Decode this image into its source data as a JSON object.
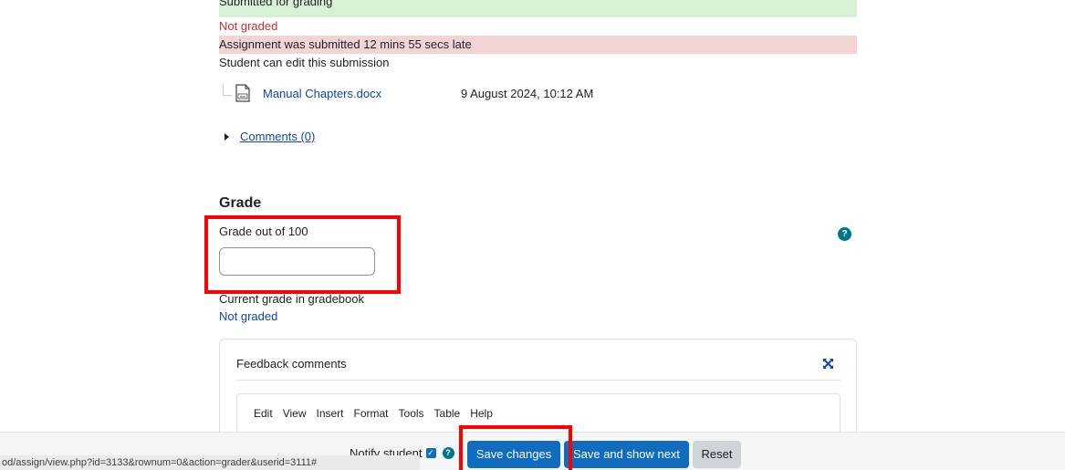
{
  "status": {
    "submitted": "Submitted for grading",
    "grading": "Not graded",
    "late": "Assignment was submitted 12 mins 55 secs late",
    "editable": "Student can edit this submission"
  },
  "file": {
    "name": "Manual Chapters.docx",
    "date": "9 August 2024, 10:12 AM",
    "icon": "docx-file-icon"
  },
  "comments": {
    "label": "Comments (0)"
  },
  "grade": {
    "heading": "Grade",
    "label": "Grade out of 100",
    "value": "",
    "current_label": "Current grade in gradebook",
    "current_value": "Not graded",
    "help_icon": "?"
  },
  "feedback": {
    "title": "Feedback comments",
    "menu": [
      "Edit",
      "View",
      "Insert",
      "Format",
      "Tools",
      "Table",
      "Help"
    ]
  },
  "footer": {
    "notify_label": "Notify student",
    "notify_checked": true,
    "save_label": "Save changes",
    "save_next_label": "Save and show next",
    "reset_label": "Reset"
  },
  "status_url": "od/assign/view.php?id=3133&rownum=0&action=grader&userid=3111#",
  "colors": {
    "primary": "#0f6cbf",
    "highlight": "#ff0000",
    "success_bg": "#d7f0d6",
    "danger_bg": "#f2d4d4"
  }
}
